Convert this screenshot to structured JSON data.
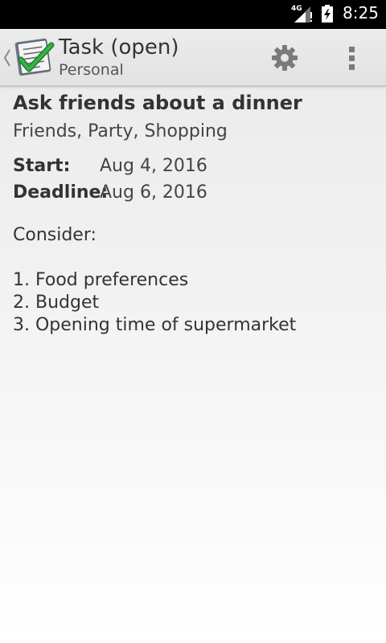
{
  "status_bar": {
    "network": "4G",
    "time": "8:25"
  },
  "action_bar": {
    "title": "Task (open)",
    "subtitle": "Personal",
    "icons": {
      "app": "checklist-icon",
      "settings": "gear-icon",
      "overflow": "overflow-menu-icon",
      "up": "back-caret-icon"
    }
  },
  "task": {
    "title": "Ask friends about a dinner",
    "tags": "Friends, Party, Shopping",
    "start_label": "Start:",
    "start_value": "Aug 4, 2016",
    "deadline_label": "Deadline:",
    "deadline_value": "Aug 6, 2016",
    "description": {
      "intro": "Consider:",
      "items": [
        "1. Food preferences",
        "2. Budget",
        "3. Opening time of supermarket"
      ]
    }
  },
  "colors": {
    "status_bar_bg": "#000000",
    "action_bar_bg": "#e6e6e6",
    "checkmark_green": "#2e9e3a",
    "text_primary": "#333333"
  }
}
